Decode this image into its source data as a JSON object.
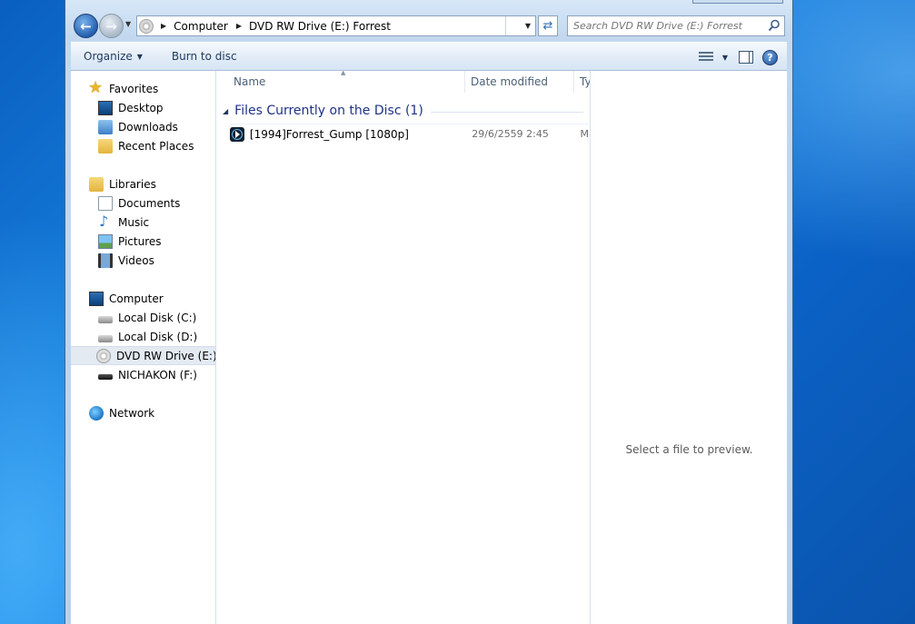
{
  "address": {
    "crumbs": [
      "Computer",
      "DVD RW Drive (E:) Forrest"
    ]
  },
  "search": {
    "placeholder": "Search DVD RW Drive (E:) Forrest"
  },
  "toolbar": {
    "organize": "Organize",
    "burn": "Burn to disc"
  },
  "nav": {
    "favorites": "Favorites",
    "desktop": "Desktop",
    "downloads": "Downloads",
    "recent": "Recent Places",
    "libraries": "Libraries",
    "documents": "Documents",
    "music": "Music",
    "pictures": "Pictures",
    "videos": "Videos",
    "computer": "Computer",
    "local_c": "Local Disk (C:)",
    "local_d": "Local Disk (D:)",
    "dvd": "DVD RW Drive (E:) Forrest",
    "nichakon": "NICHAKON (F:)",
    "network": "Network"
  },
  "columns": {
    "name": "Name",
    "date": "Date modified",
    "type": "Ty"
  },
  "group": {
    "label": "Files Currently on the Disc (1)"
  },
  "file": {
    "name": "[1994]Forrest_Gump [1080p]",
    "date": "29/6/2559 2:45",
    "type": "M"
  },
  "preview": {
    "message": "Select a file to preview."
  }
}
